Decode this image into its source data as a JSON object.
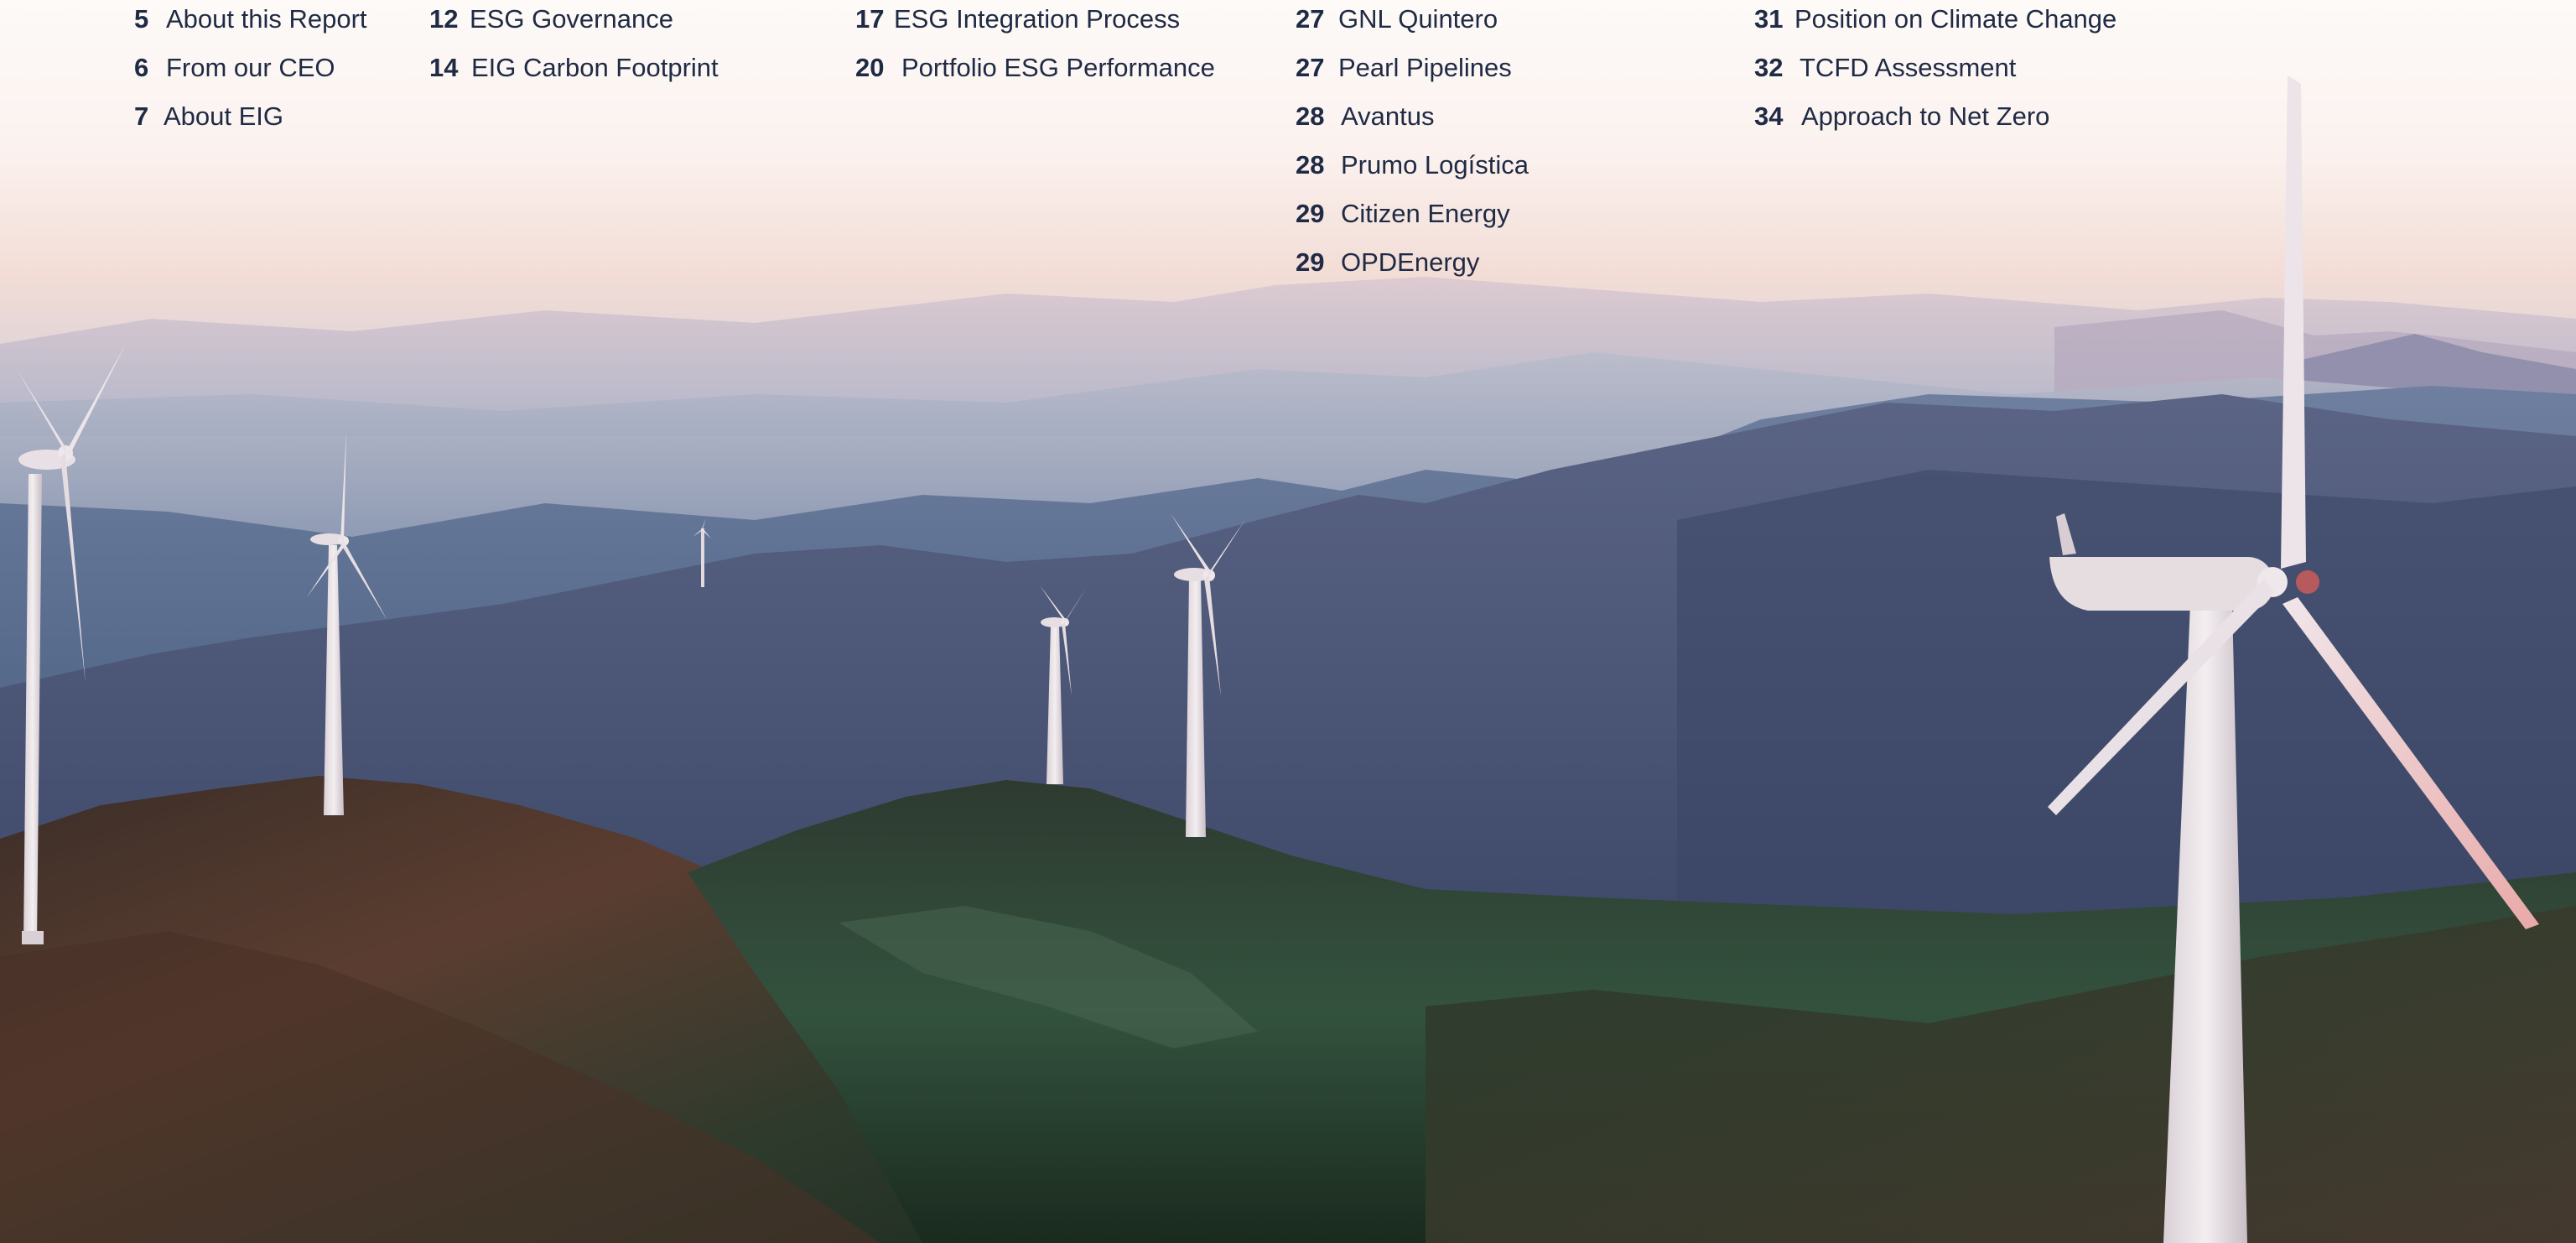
{
  "toc": {
    "columns": [
      {
        "entries": [
          {
            "page": "5",
            "title": "About this Report"
          },
          {
            "page": "6",
            "title": "From our CEO"
          },
          {
            "page": "7",
            "title": "About EIG"
          }
        ]
      },
      {
        "entries": [
          {
            "page": "12",
            "title": "ESG Governance"
          },
          {
            "page": "14",
            "title": "EIG Carbon Footprint"
          }
        ]
      },
      {
        "entries": [
          {
            "page": "17",
            "title": "ESG Integration Process"
          },
          {
            "page": "20",
            "title": "Portfolio ESG Performance"
          }
        ]
      },
      {
        "entries": [
          {
            "page": "27",
            "title": "GNL Quintero"
          },
          {
            "page": "27",
            "title": "Pearl Pipelines"
          },
          {
            "page": "28",
            "title": "Avantus"
          },
          {
            "page": "28",
            "title": "Prumo Logística"
          },
          {
            "page": "29",
            "title": "Citizen Energy"
          },
          {
            "page": "29",
            "title": "OPDEnergy"
          }
        ]
      },
      {
        "entries": [
          {
            "page": "31",
            "title": "Position on Climate Change"
          },
          {
            "page": "32",
            "title": "TCFD Assessment"
          },
          {
            "page": "34",
            "title": "Approach to Net Zero"
          }
        ]
      }
    ]
  },
  "scene": {
    "subject": "wind-turbines-mountain-landscape",
    "colors": {
      "sky_top": "#fdfaf8",
      "sky_glow": "#f6dcd4",
      "haze": "#c9cad6",
      "far_ridge": "#9aa0b6",
      "mid_ridge": "#55607e",
      "near_ridge": "#3a4466",
      "forest_dark": "#1e2a20",
      "forest_warm": "#5a3a2c",
      "forest_green": "#2f4a38",
      "turbine": "#eae4e6",
      "text": "#1f2a44"
    }
  }
}
